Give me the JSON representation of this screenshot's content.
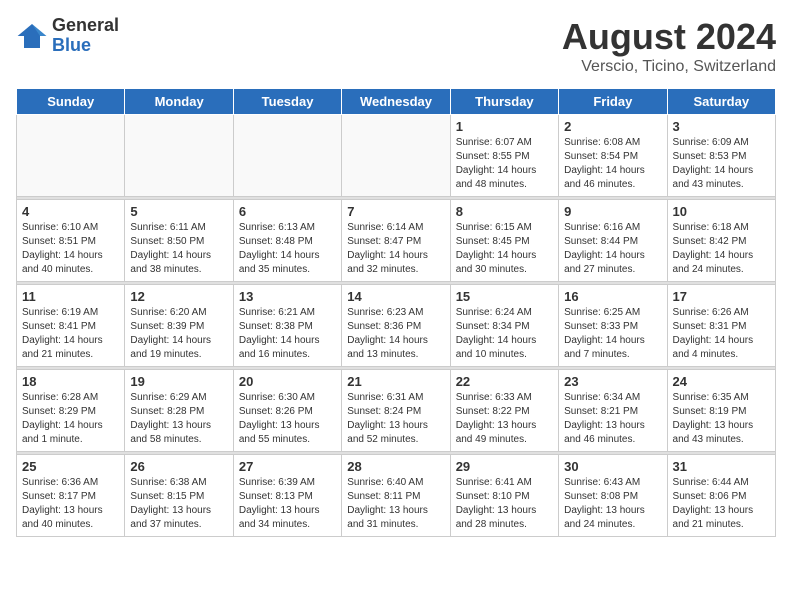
{
  "header": {
    "logo_general": "General",
    "logo_blue": "Blue",
    "title": "August 2024",
    "subtitle": "Verscio, Ticino, Switzerland"
  },
  "weekdays": [
    "Sunday",
    "Monday",
    "Tuesday",
    "Wednesday",
    "Thursday",
    "Friday",
    "Saturday"
  ],
  "weeks": [
    [
      {
        "day": "",
        "info": ""
      },
      {
        "day": "",
        "info": ""
      },
      {
        "day": "",
        "info": ""
      },
      {
        "day": "",
        "info": ""
      },
      {
        "day": "1",
        "info": "Sunrise: 6:07 AM\nSunset: 8:55 PM\nDaylight: 14 hours\nand 48 minutes."
      },
      {
        "day": "2",
        "info": "Sunrise: 6:08 AM\nSunset: 8:54 PM\nDaylight: 14 hours\nand 46 minutes."
      },
      {
        "day": "3",
        "info": "Sunrise: 6:09 AM\nSunset: 8:53 PM\nDaylight: 14 hours\nand 43 minutes."
      }
    ],
    [
      {
        "day": "4",
        "info": "Sunrise: 6:10 AM\nSunset: 8:51 PM\nDaylight: 14 hours\nand 40 minutes."
      },
      {
        "day": "5",
        "info": "Sunrise: 6:11 AM\nSunset: 8:50 PM\nDaylight: 14 hours\nand 38 minutes."
      },
      {
        "day": "6",
        "info": "Sunrise: 6:13 AM\nSunset: 8:48 PM\nDaylight: 14 hours\nand 35 minutes."
      },
      {
        "day": "7",
        "info": "Sunrise: 6:14 AM\nSunset: 8:47 PM\nDaylight: 14 hours\nand 32 minutes."
      },
      {
        "day": "8",
        "info": "Sunrise: 6:15 AM\nSunset: 8:45 PM\nDaylight: 14 hours\nand 30 minutes."
      },
      {
        "day": "9",
        "info": "Sunrise: 6:16 AM\nSunset: 8:44 PM\nDaylight: 14 hours\nand 27 minutes."
      },
      {
        "day": "10",
        "info": "Sunrise: 6:18 AM\nSunset: 8:42 PM\nDaylight: 14 hours\nand 24 minutes."
      }
    ],
    [
      {
        "day": "11",
        "info": "Sunrise: 6:19 AM\nSunset: 8:41 PM\nDaylight: 14 hours\nand 21 minutes."
      },
      {
        "day": "12",
        "info": "Sunrise: 6:20 AM\nSunset: 8:39 PM\nDaylight: 14 hours\nand 19 minutes."
      },
      {
        "day": "13",
        "info": "Sunrise: 6:21 AM\nSunset: 8:38 PM\nDaylight: 14 hours\nand 16 minutes."
      },
      {
        "day": "14",
        "info": "Sunrise: 6:23 AM\nSunset: 8:36 PM\nDaylight: 14 hours\nand 13 minutes."
      },
      {
        "day": "15",
        "info": "Sunrise: 6:24 AM\nSunset: 8:34 PM\nDaylight: 14 hours\nand 10 minutes."
      },
      {
        "day": "16",
        "info": "Sunrise: 6:25 AM\nSunset: 8:33 PM\nDaylight: 14 hours\nand 7 minutes."
      },
      {
        "day": "17",
        "info": "Sunrise: 6:26 AM\nSunset: 8:31 PM\nDaylight: 14 hours\nand 4 minutes."
      }
    ],
    [
      {
        "day": "18",
        "info": "Sunrise: 6:28 AM\nSunset: 8:29 PM\nDaylight: 14 hours\nand 1 minute."
      },
      {
        "day": "19",
        "info": "Sunrise: 6:29 AM\nSunset: 8:28 PM\nDaylight: 13 hours\nand 58 minutes."
      },
      {
        "day": "20",
        "info": "Sunrise: 6:30 AM\nSunset: 8:26 PM\nDaylight: 13 hours\nand 55 minutes."
      },
      {
        "day": "21",
        "info": "Sunrise: 6:31 AM\nSunset: 8:24 PM\nDaylight: 13 hours\nand 52 minutes."
      },
      {
        "day": "22",
        "info": "Sunrise: 6:33 AM\nSunset: 8:22 PM\nDaylight: 13 hours\nand 49 minutes."
      },
      {
        "day": "23",
        "info": "Sunrise: 6:34 AM\nSunset: 8:21 PM\nDaylight: 13 hours\nand 46 minutes."
      },
      {
        "day": "24",
        "info": "Sunrise: 6:35 AM\nSunset: 8:19 PM\nDaylight: 13 hours\nand 43 minutes."
      }
    ],
    [
      {
        "day": "25",
        "info": "Sunrise: 6:36 AM\nSunset: 8:17 PM\nDaylight: 13 hours\nand 40 minutes."
      },
      {
        "day": "26",
        "info": "Sunrise: 6:38 AM\nSunset: 8:15 PM\nDaylight: 13 hours\nand 37 minutes."
      },
      {
        "day": "27",
        "info": "Sunrise: 6:39 AM\nSunset: 8:13 PM\nDaylight: 13 hours\nand 34 minutes."
      },
      {
        "day": "28",
        "info": "Sunrise: 6:40 AM\nSunset: 8:11 PM\nDaylight: 13 hours\nand 31 minutes."
      },
      {
        "day": "29",
        "info": "Sunrise: 6:41 AM\nSunset: 8:10 PM\nDaylight: 13 hours\nand 28 minutes."
      },
      {
        "day": "30",
        "info": "Sunrise: 6:43 AM\nSunset: 8:08 PM\nDaylight: 13 hours\nand 24 minutes."
      },
      {
        "day": "31",
        "info": "Sunrise: 6:44 AM\nSunset: 8:06 PM\nDaylight: 13 hours\nand 21 minutes."
      }
    ]
  ]
}
